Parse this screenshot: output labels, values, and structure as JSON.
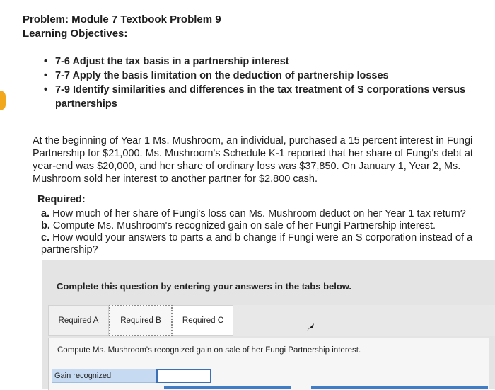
{
  "problem_title": "Problem: Module 7 Textbook Problem 9",
  "objectives_title": "Learning Objectives:",
  "objectives": [
    "7-6 Adjust the tax basis in a partnership interest",
    "7-7 Apply the basis limitation on the deduction of partnership losses",
    "7-9 Identify similarities and differences in the tax treatment of S corporations versus partnerships"
  ],
  "problem_text": "At the beginning of Year 1 Ms. Mushroom, an individual, purchased a 15 percent interest in Fungi Partnership for $21,000. Ms. Mushroom's Schedule K-1 reported that her share of Fungi's debt at year-end was $20,000, and her share of ordinary loss was $37,850. On January 1, Year 2, Ms. Mushroom sold her interest to another partner for $2,800 cash.",
  "required_title": "Required:",
  "parts": [
    {
      "label": "a.",
      "text": "How much of her share of Fungi's loss can Ms. Mushroom deduct on her Year 1 tax return?"
    },
    {
      "label": "b.",
      "text": "Compute Ms. Mushroom's recognized gain on sale of her Fungi Partnership interest."
    },
    {
      "label": "c.",
      "text": "How would your answers to parts a and b change if Fungi were an S corporation instead of a partnership?"
    }
  ],
  "panel_instruction": "Complete this question by entering your answers in the tabs below.",
  "tabs": [
    "Required A",
    "Required B",
    "Required C"
  ],
  "content_instruction": "Compute Ms. Mushroom's recognized gain on sale of her Fungi Partnership interest.",
  "answer_label": "Gain recognized",
  "answer_value": "",
  "colors": {
    "accent": "#f2a81d",
    "label_bg": "#c6dbf1",
    "input_border": "#3b6fb6"
  }
}
